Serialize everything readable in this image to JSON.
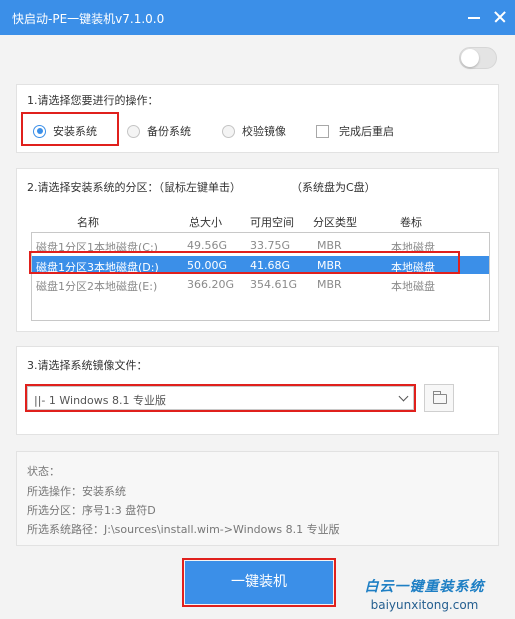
{
  "window": {
    "title": "快启动-PE一键装机v7.1.0.0"
  },
  "section1": {
    "title": "1.请选择您要进行的操作：",
    "options": [
      "安装系统",
      "备份系统",
      "校验镜像"
    ],
    "selected": "安装系统",
    "checkbox_label": "完成后重启",
    "checkbox_checked": false
  },
  "section2": {
    "title": "2.请选择安装系统的分区：（鼠标左键单击）",
    "hint": "（系统盘为C盘）",
    "columns": [
      "名称",
      "总大小",
      "可用空间",
      "分区类型",
      "卷标"
    ],
    "rows": [
      [
        "磁盘1分区1本地磁盘(C:)",
        "49.56G",
        "33.75G",
        "MBR",
        "本地磁盘"
      ],
      [
        "磁盘1分区3本地磁盘(D:)",
        "50.00G",
        "41.68G",
        "MBR",
        "本地磁盘"
      ],
      [
        "磁盘1分区2本地磁盘(E:)",
        "366.20G",
        "354.61G",
        "MBR",
        "本地磁盘"
      ]
    ],
    "selected_row": 1
  },
  "section3": {
    "title": "3.请选择系统镜像文件：",
    "image_value": "||- 1 Windows  8.1 专业版"
  },
  "status": {
    "heading": "状态：",
    "operation": "所选操作：安装系统",
    "partition": "所选分区：序号1:3    盘符D",
    "path": "所选系统路径：J:\\sources\\install.wim->Windows  8.1 专业版"
  },
  "install_button": "一键装机",
  "watermark": {
    "brand": "白云一键重装系统",
    "url": "baiyunxitong.com"
  },
  "colors": {
    "accent": "#3b8fe8",
    "highlight": "#e0201c"
  }
}
